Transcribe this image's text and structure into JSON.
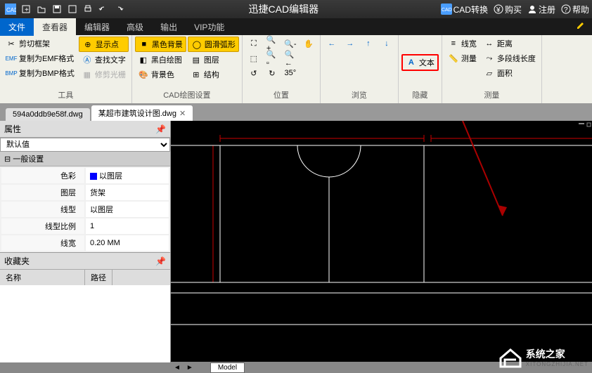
{
  "titlebar": {
    "title": "迅捷CAD编辑器",
    "right": {
      "convert": "CAD转换",
      "buy": "购买",
      "register": "注册",
      "help": "帮助"
    }
  },
  "menubar": {
    "file": "文件",
    "viewer": "查看器",
    "editor": "编辑器",
    "advanced": "高级",
    "output": "输出",
    "vip": "VIP功能"
  },
  "ribbon": {
    "tools": {
      "label": "工具",
      "clip_frame": "剪切框架",
      "copy_emf": "复制为EMF格式",
      "copy_bmp": "复制为BMP格式",
      "show_point": "显示点",
      "find_text": "查找文字",
      "trim_raster": "修剪光栅"
    },
    "cad_draw": {
      "label": "CAD绘图设置",
      "black_bg": "黑色背景",
      "bw_draw": "黑白绘图",
      "bg_color": "背景色",
      "smooth_arc": "圆滑弧形",
      "layers": "图层",
      "structure": "结构"
    },
    "position": {
      "label": "位置"
    },
    "browse": {
      "label": "浏览"
    },
    "hide": {
      "label": "隐藏",
      "text": "文本"
    },
    "measure": {
      "label": "测量",
      "linewidth": "线宽",
      "measure": "测量",
      "distance": "距离",
      "polyline_len": "多段线长度",
      "area": "面积"
    }
  },
  "doctabs": {
    "tab1": "594a0ddb9e58f.dwg",
    "tab2": "某超市建筑设计图.dwg"
  },
  "properties": {
    "title": "属性",
    "default": "默认值",
    "general": "一般设置",
    "rows": {
      "color_label": "色彩",
      "color_value": "以图层",
      "layer_label": "图层",
      "layer_value": "货架",
      "linetype_label": "线型",
      "linetype_value": "以图层",
      "scale_label": "线型比例",
      "scale_value": "1",
      "width_label": "线宽",
      "width_value": "0.20 MM"
    }
  },
  "favorites": {
    "title": "收藏夹",
    "name": "名称",
    "path": "路径"
  },
  "bottom": {
    "model": "Model"
  },
  "watermark": {
    "text": "系统之家",
    "url": "XITONGZHIJIA.NET"
  }
}
